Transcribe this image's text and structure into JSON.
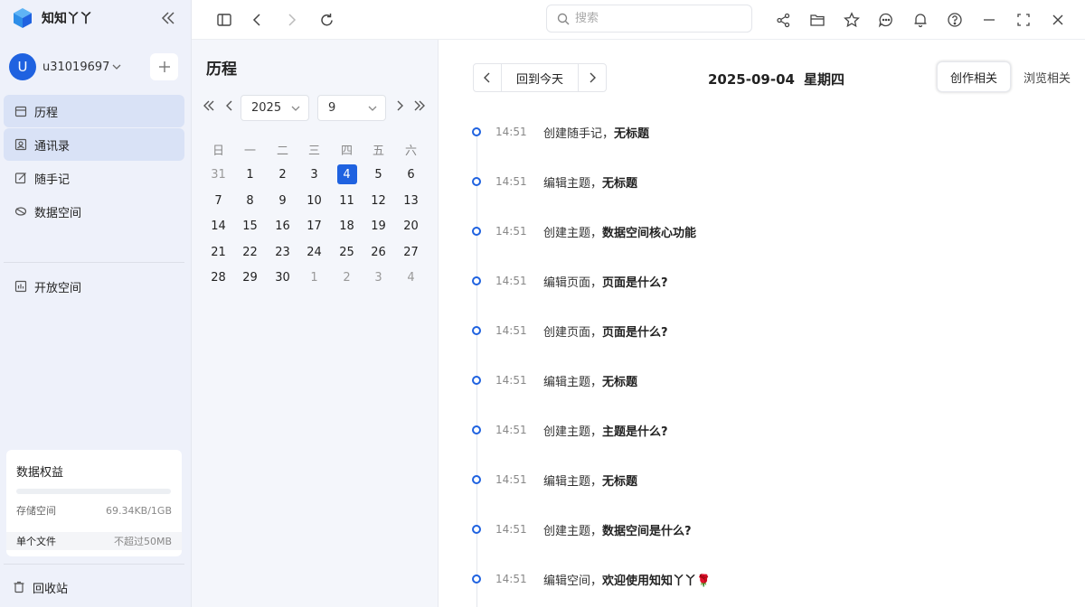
{
  "app": {
    "name": "知知丫丫"
  },
  "user": {
    "avatar_letter": "U",
    "name": "u31019697"
  },
  "sidebar": {
    "items": [
      {
        "label": "历程",
        "icon": "calendar-icon",
        "active": true
      },
      {
        "label": "通讯录",
        "icon": "contact-icon",
        "active": true
      },
      {
        "label": "随手记",
        "icon": "edit-icon",
        "active": false
      },
      {
        "label": "数据空间",
        "icon": "data-space-icon",
        "active": false
      },
      {
        "label": "开放空间",
        "icon": "open-space-icon",
        "active": false
      }
    ],
    "quota": {
      "title": "数据权益",
      "storage_label": "存储空间",
      "storage_value": "69.34KB/1GB",
      "storage_fraction": 0.0001,
      "file_label": "单个文件",
      "file_value": "不超过50MB"
    },
    "trash_label": "回收站"
  },
  "topbar": {
    "search_placeholder": "搜索"
  },
  "calendar": {
    "title": "历程",
    "year": "2025",
    "month": "9",
    "weekdays": [
      "日",
      "一",
      "二",
      "三",
      "四",
      "五",
      "六"
    ],
    "weeks": [
      [
        {
          "d": "31",
          "m": true
        },
        {
          "d": "1"
        },
        {
          "d": "2"
        },
        {
          "d": "3"
        },
        {
          "d": "4",
          "s": true
        },
        {
          "d": "5"
        },
        {
          "d": "6"
        }
      ],
      [
        {
          "d": "7"
        },
        {
          "d": "8"
        },
        {
          "d": "9"
        },
        {
          "d": "10"
        },
        {
          "d": "11"
        },
        {
          "d": "12"
        },
        {
          "d": "13"
        }
      ],
      [
        {
          "d": "14"
        },
        {
          "d": "15"
        },
        {
          "d": "16"
        },
        {
          "d": "17"
        },
        {
          "d": "18"
        },
        {
          "d": "19"
        },
        {
          "d": "20"
        }
      ],
      [
        {
          "d": "21"
        },
        {
          "d": "22"
        },
        {
          "d": "23"
        },
        {
          "d": "24"
        },
        {
          "d": "25"
        },
        {
          "d": "26"
        },
        {
          "d": "27"
        }
      ],
      [
        {
          "d": "28"
        },
        {
          "d": "29"
        },
        {
          "d": "30"
        },
        {
          "d": "1",
          "m": true
        },
        {
          "d": "2",
          "m": true
        },
        {
          "d": "3",
          "m": true
        },
        {
          "d": "4",
          "m": true
        }
      ]
    ]
  },
  "content": {
    "today_label": "回到今天",
    "date": "2025-09-04",
    "weekday": "星期四",
    "tabs": [
      {
        "label": "创作相关",
        "active": true
      },
      {
        "label": "浏览相关",
        "active": false
      }
    ],
    "timeline": [
      {
        "time": "14:51",
        "action": "创建随手记，",
        "target": "无标题"
      },
      {
        "time": "14:51",
        "action": "编辑主题，",
        "target": "无标题"
      },
      {
        "time": "14:51",
        "action": "创建主题，",
        "target": "数据空间核心功能"
      },
      {
        "time": "14:51",
        "action": "编辑页面，",
        "target": "页面是什么?"
      },
      {
        "time": "14:51",
        "action": "创建页面，",
        "target": "页面是什么?"
      },
      {
        "time": "14:51",
        "action": "编辑主题，",
        "target": "无标题"
      },
      {
        "time": "14:51",
        "action": "创建主题，",
        "target": "主题是什么?"
      },
      {
        "time": "14:51",
        "action": "编辑主题，",
        "target": "无标题"
      },
      {
        "time": "14:51",
        "action": "创建主题，",
        "target": "数据空间是什么?"
      },
      {
        "time": "14:51",
        "action": "编辑空间，",
        "target": "欢迎使用知知丫丫🌹"
      }
    ]
  }
}
